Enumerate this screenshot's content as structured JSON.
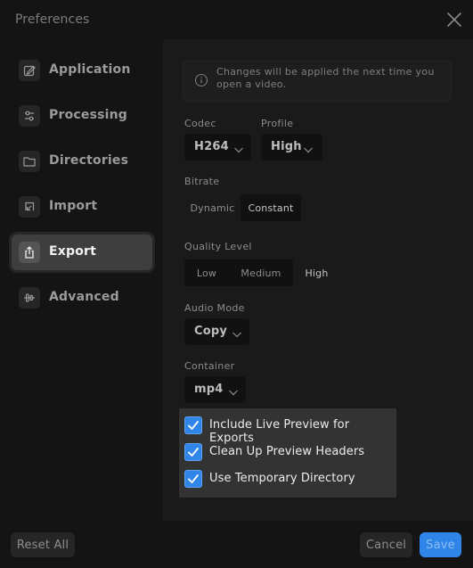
{
  "window": {
    "title": "Preferences"
  },
  "sidebar": {
    "items": [
      {
        "label": "Application",
        "icon": "edit-icon"
      },
      {
        "label": "Processing",
        "icon": "sliders-icon"
      },
      {
        "label": "Directories",
        "icon": "folder-icon"
      },
      {
        "label": "Import",
        "icon": "import-icon"
      },
      {
        "label": "Export",
        "icon": "share-icon",
        "selected": true
      },
      {
        "label": "Advanced",
        "icon": "waveform-icon"
      }
    ]
  },
  "notice": {
    "text": "Changes will be applied the next time you open a video.",
    "icon": "info-icon"
  },
  "codec": {
    "label": "Codec",
    "value": "H264"
  },
  "profile": {
    "label": "Profile",
    "value": "High"
  },
  "bitrate": {
    "label": "Bitrate",
    "options": [
      "Dynamic",
      "Constant"
    ],
    "selected": "Constant"
  },
  "quality": {
    "label": "Quality Level",
    "options": [
      "Low",
      "Medium",
      "High"
    ],
    "selected": "High"
  },
  "audio_mode": {
    "label": "Audio Mode",
    "value": "Copy"
  },
  "container": {
    "label": "Container",
    "value": "mp4"
  },
  "checkboxes": [
    {
      "label": "Include Live Preview for Exports",
      "checked": true
    },
    {
      "label": "Clean Up Preview Headers",
      "checked": true
    },
    {
      "label": "Use Temporary Directory",
      "checked": true
    }
  ],
  "footer": {
    "reset_label": "Reset All",
    "cancel_label": "Cancel",
    "save_label": "Save"
  },
  "colors": {
    "accent": "#2f86e8",
    "background": "#141414",
    "panel": "#1a1a1a"
  }
}
